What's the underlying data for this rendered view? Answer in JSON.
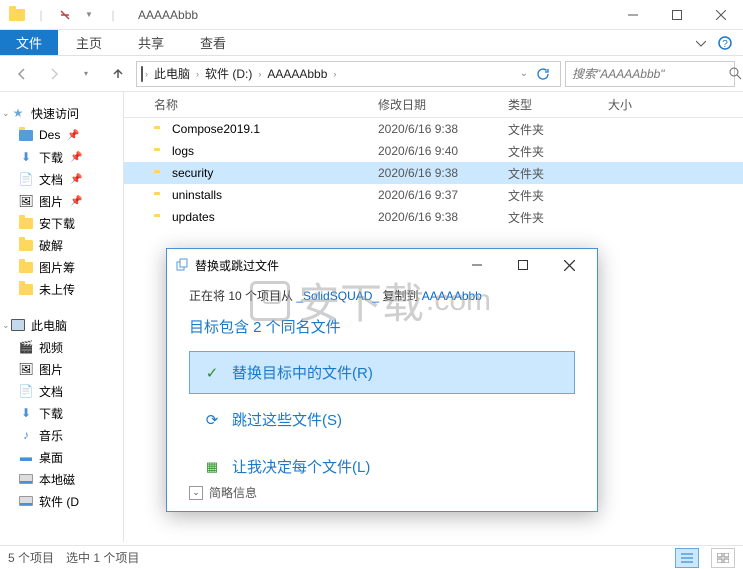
{
  "title": "AAAAAbbb",
  "ribbon": {
    "file": "文件",
    "tabs": [
      "主页",
      "共享",
      "查看"
    ]
  },
  "breadcrumb": [
    "此电脑",
    "软件 (D:)",
    "AAAAAbbb"
  ],
  "search": {
    "placeholder": "搜索\"AAAAAbbb\""
  },
  "columns": {
    "name": "名称",
    "date": "修改日期",
    "type": "类型",
    "size": "大小"
  },
  "files": [
    {
      "name": "Compose2019.1",
      "date": "2020/6/16 9:38",
      "type": "文件夹",
      "selected": false
    },
    {
      "name": "logs",
      "date": "2020/6/16 9:40",
      "type": "文件夹",
      "selected": false
    },
    {
      "name": "security",
      "date": "2020/6/16 9:38",
      "type": "文件夹",
      "selected": true
    },
    {
      "name": "uninstalls",
      "date": "2020/6/16 9:37",
      "type": "文件夹",
      "selected": false
    },
    {
      "name": "updates",
      "date": "2020/6/16 9:38",
      "type": "文件夹",
      "selected": false
    }
  ],
  "sidebar": {
    "quick": {
      "label": "快速访问",
      "items": [
        "Des",
        "下载",
        "文档",
        "图片",
        "安下载",
        "破解",
        "图片筹",
        "未上传"
      ]
    },
    "pc": {
      "label": "此电脑",
      "items": [
        "视频",
        "图片",
        "文档",
        "下载",
        "音乐",
        "桌面",
        "本地磁",
        "软件 (D"
      ]
    }
  },
  "status": {
    "count": "5 个项目",
    "selected": "选中 1 个项目"
  },
  "dialog": {
    "title": "替换或跳过文件",
    "copy_prefix": "正在将 10 个项目从",
    "copy_src": "_SolidSQUAD_",
    "copy_mid": "复制到",
    "copy_dst": "AAAAAbbb",
    "heading": "目标包含 2 个同名文件",
    "opt_replace": "替换目标中的文件(R)",
    "opt_skip": "跳过这些文件(S)",
    "opt_let": "让我决定每个文件(L)",
    "details": "简略信息"
  },
  "watermark": "安下载"
}
